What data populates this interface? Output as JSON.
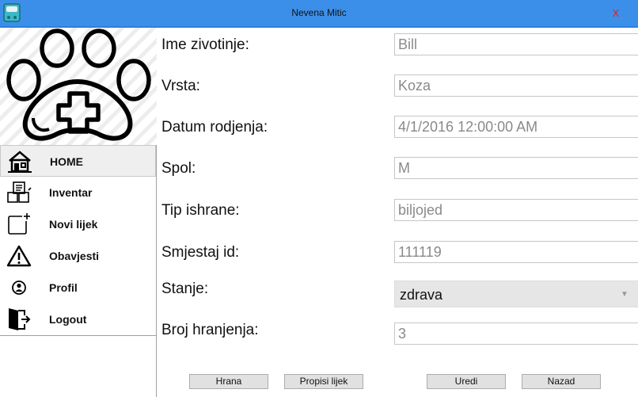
{
  "window": {
    "title": "Nevena Mitic",
    "close_label": "X"
  },
  "nav": [
    {
      "label": "HOME",
      "icon": "home-icon"
    },
    {
      "label": "Inventar",
      "icon": "inventory-icon"
    },
    {
      "label": "Novi lijek",
      "icon": "new-item-icon"
    },
    {
      "label": "Obavjesti",
      "icon": "warning-icon"
    },
    {
      "label": "Profil",
      "icon": "user-icon"
    },
    {
      "label": "Logout",
      "icon": "exit-door-icon"
    }
  ],
  "form": {
    "labels": {
      "name": "Ime zivotinje:",
      "species": "Vrsta:",
      "birthdate": "Datum rodjenja:",
      "sex": "Spol:",
      "diet": "Tip ishrane:",
      "housing": "Smjestaj id:",
      "status": "Stanje:",
      "feedings": "Broj hranjenja:"
    },
    "values": {
      "name": "Bill",
      "species": "Koza",
      "birthdate": "4/1/2016 12:00:00 AM",
      "sex": "M",
      "diet": "biljojed",
      "housing": "111119",
      "status": "zdrava",
      "feedings": "3"
    }
  },
  "buttons": {
    "food": "Hrana",
    "prescribe": "Propisi lijek",
    "edit": "Uredi",
    "back": "Nazad"
  }
}
